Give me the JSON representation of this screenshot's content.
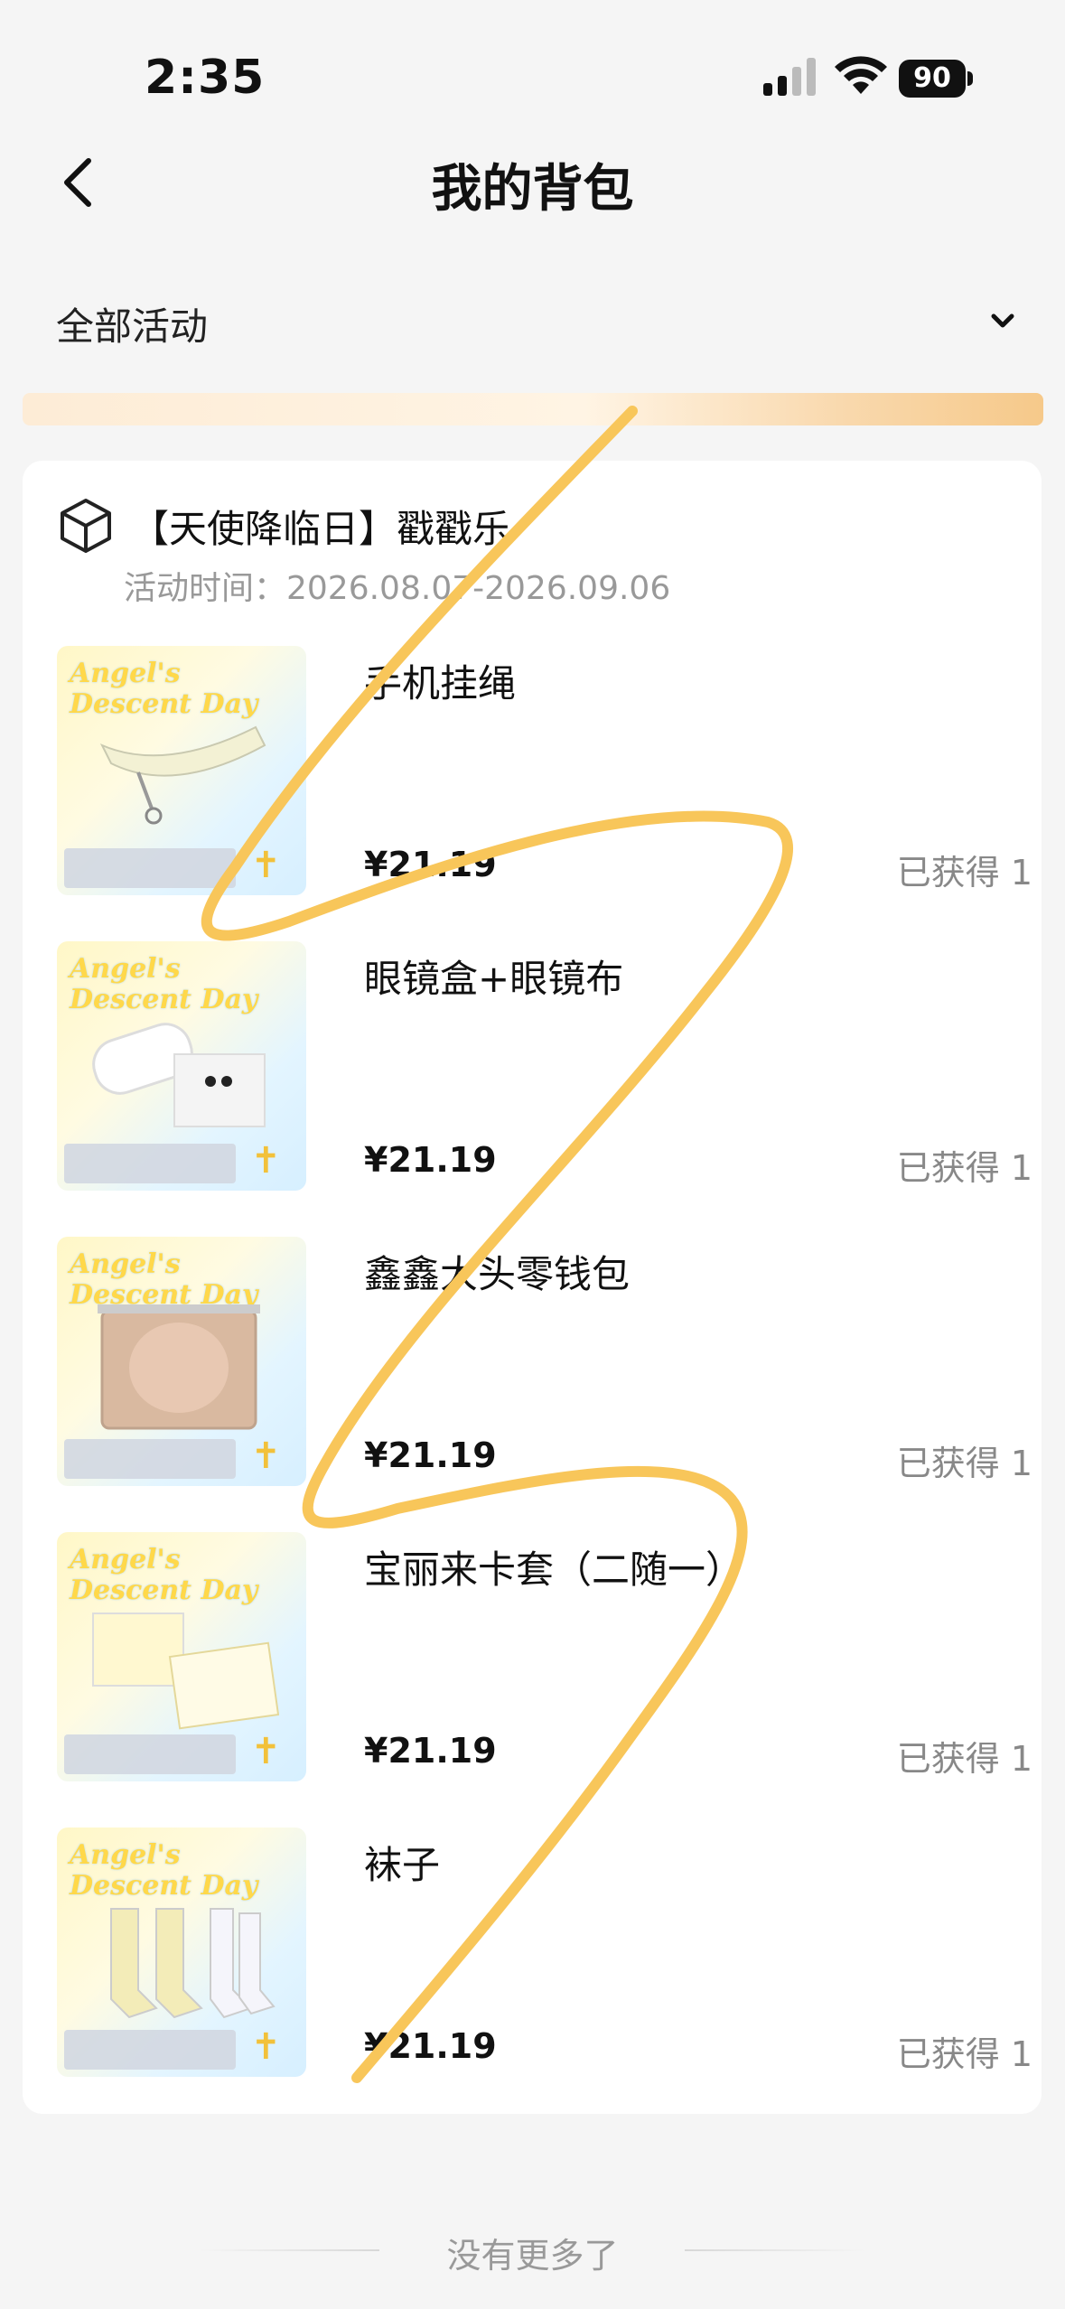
{
  "status_bar": {
    "time": "2:35",
    "battery": "90"
  },
  "header": {
    "title": "我的背包",
    "back_icon": "chevron-left-icon"
  },
  "filter": {
    "selected": "全部活动",
    "dropdown_icon": "chevron-down-icon"
  },
  "activity": {
    "title": "【天使降临日】戳戳乐",
    "time": "活动时间：2026.08.07-2026.09.06",
    "icon": "box-icon"
  },
  "items": [
    {
      "name": "手机挂绳",
      "price": "¥21.19",
      "owned": "已获得 1"
    },
    {
      "name": "眼镜盒+眼镜布",
      "price": "¥21.19",
      "owned": "已获得 1"
    },
    {
      "name": "鑫鑫大头零钱包",
      "price": "¥21.19",
      "owned": "已获得 1"
    },
    {
      "name": "宝丽来卡套（二随一）",
      "price": "¥21.19",
      "owned": "已获得 1"
    },
    {
      "name": "袜子",
      "price": "¥21.19",
      "owned": "已获得 1"
    }
  ],
  "thumb_brand": "Angel's Descent Day",
  "footer": {
    "text": "没有更多了"
  },
  "colors": {
    "scribble": "#f8c65a",
    "accent_yellow": "#ffd84a"
  }
}
